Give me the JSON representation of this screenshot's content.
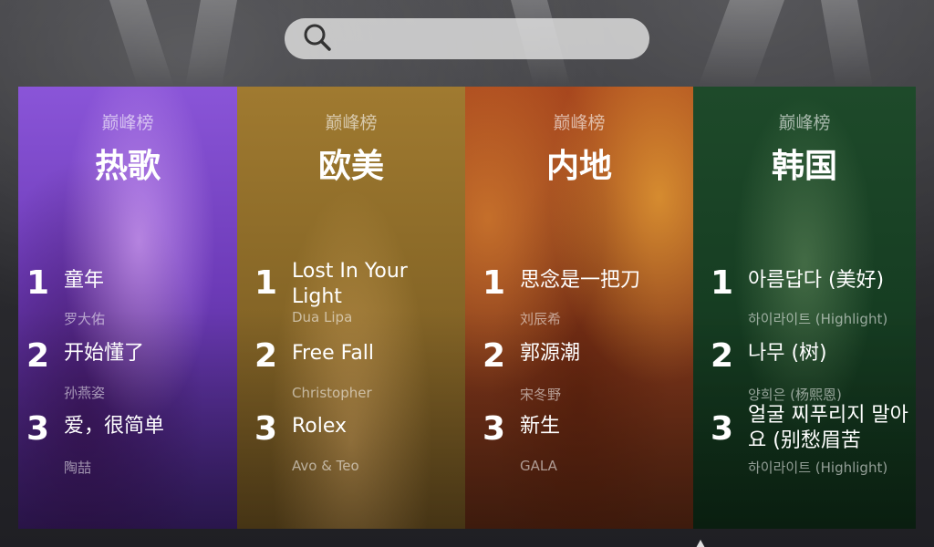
{
  "search": {
    "placeholder": ""
  },
  "cards": [
    {
      "subtitle": "巅峰榜",
      "title": "热歌",
      "items": [
        {
          "rank": "1",
          "song": "童年",
          "artist": "罗大佑"
        },
        {
          "rank": "2",
          "song": "开始懂了",
          "artist": "孙燕姿"
        },
        {
          "rank": "3",
          "song": "爱，很简单",
          "artist": "陶喆"
        }
      ]
    },
    {
      "subtitle": "巅峰榜",
      "title": "欧美",
      "items": [
        {
          "rank": "1",
          "song": "Lost In Your Light",
          "artist": "Dua Lipa"
        },
        {
          "rank": "2",
          "song": "Free Fall",
          "artist": "Christopher"
        },
        {
          "rank": "3",
          "song": "Rolex",
          "artist": "Avo & Teo"
        }
      ]
    },
    {
      "subtitle": "巅峰榜",
      "title": "内地",
      "items": [
        {
          "rank": "1",
          "song": "思念是一把刀",
          "artist": "刘辰希"
        },
        {
          "rank": "2",
          "song": "郭源潮",
          "artist": "宋冬野"
        },
        {
          "rank": "3",
          "song": "新生",
          "artist": "GALA"
        }
      ]
    },
    {
      "subtitle": "巅峰榜",
      "title": "韩国",
      "items": [
        {
          "rank": "1",
          "song": "아름답다 (美好)",
          "artist": "하이라이트 (Highlight)"
        },
        {
          "rank": "2",
          "song": "나무 (树)",
          "artist": "양희은 (杨熙恩)"
        },
        {
          "rank": "3",
          "song": "얼굴 찌푸리지 말아요 (别愁眉苦",
          "artist": "하이라이트 (Highlight)"
        }
      ]
    }
  ]
}
